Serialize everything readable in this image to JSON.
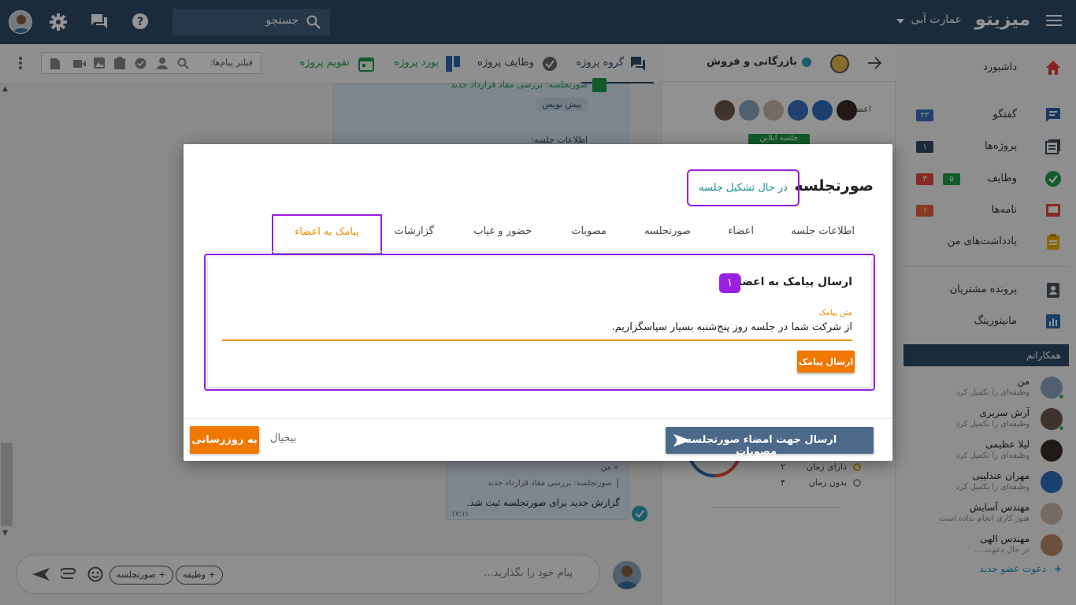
{
  "topbar": {
    "logo": "میزیتو",
    "company": "عمارت آبی",
    "search_placeholder": "جستجو"
  },
  "sidebar": {
    "items": [
      {
        "label": "داشبورد",
        "icon": "home-icon"
      },
      {
        "label": "گفتگو",
        "icon": "chat-icon",
        "badge": "۲۳"
      },
      {
        "label": "پروژه‌ها",
        "icon": "projects-icon",
        "badge": "۱"
      },
      {
        "label": "وظایف",
        "icon": "tasks-icon",
        "badge_green": "۵",
        "badge_red": "۳"
      },
      {
        "label": "نامه‌ها",
        "icon": "letters-icon",
        "badge": "۱"
      },
      {
        "label": "یادداشت‌های من",
        "icon": "notes-icon"
      },
      {
        "label": "پرونده مشتریان",
        "icon": "contacts-icon"
      },
      {
        "label": "مانیتورینگ",
        "icon": "monitoring-icon"
      }
    ],
    "colleagues_title": "همکارانم",
    "colleagues": [
      {
        "name": "من",
        "status": "وظیفه‌ای را تکمیل کرد"
      },
      {
        "name": "آرش سریری",
        "status": "وظیفه‌ای را تکمیل کرد"
      },
      {
        "name": "لیلا عظیمی",
        "status": "وظیفه‌ای را تکمیل کرد"
      },
      {
        "name": "مهران عندلیبی",
        "status": "وظیفه‌ای را تکمیل کرد"
      },
      {
        "name": "مهندس آسایش",
        "status": "هنوز کاری انجام نداده است"
      },
      {
        "name": "مهندس الهی",
        "status": "در حال دعوت ..."
      }
    ],
    "invite": "دعوت عضو جدید"
  },
  "channel": {
    "title": "بازرگانی و فروش",
    "members_label": "اعضاء:",
    "online_meeting": "جلسه آنلاین",
    "legend": [
      {
        "label": "دارای زمان",
        "count": "۲"
      },
      {
        "label": "بدون زمان",
        "count": "۴"
      }
    ]
  },
  "chat": {
    "tabs": [
      {
        "label": "گروه پروژه"
      },
      {
        "label": "وظایف پروژه"
      },
      {
        "label": "بورد پروژه"
      },
      {
        "label": "تقویم پروژه"
      }
    ],
    "filter_placeholder": "فیلتر پیام‌ها:",
    "msg_top_title": "صورتجلسه: بررسی مفاد قرارداد جدید",
    "msg_top_draft": "پیش نویس",
    "msg_top_info": "اطلاعات جلسه:",
    "msg_bottom_author": "« من",
    "msg_bottom_quote": "صورتجلسه: بررسی مفاد قرارداد جدید",
    "msg_bottom_text": "گزارش جدید برای صورتجلسه ثبت شد.",
    "msg_bottom_time": "۱۷:۱۱",
    "composer_placeholder": "پیام خود را بگذارید...",
    "chip_task": "+ وظیفه",
    "chip_minutes": "+ صورتجلسه"
  },
  "modal": {
    "title": "صورتجلسه",
    "status": "در حال تشکیل جلسه",
    "tabs": [
      "اطلاعات جلسه",
      "اعضاء",
      "صورتجلسه",
      "مصوبات",
      "حضور و غیاب",
      "گزارشات",
      "پیامک به اعضاء"
    ],
    "section_title": "ارسال پیامک به اعضاء",
    "step": "۱",
    "field_label": "متن پیامک",
    "field_value": "از شرکت شما در جلسه روز پنج‌شنبه بسیار سپاسگزاریم.",
    "send_sms": "ارسال پیامک",
    "btn_sign": "ارسال جهت امضاء صورتجلسه و مصوبات",
    "btn_cancel": "بیخیال",
    "btn_update": "به روزرسانی"
  },
  "colors": {
    "topbar": "#2d4a66",
    "accent_orange": "#f07800",
    "highlight_purple": "#9a1fe0",
    "teal": "#1a8f9a"
  }
}
